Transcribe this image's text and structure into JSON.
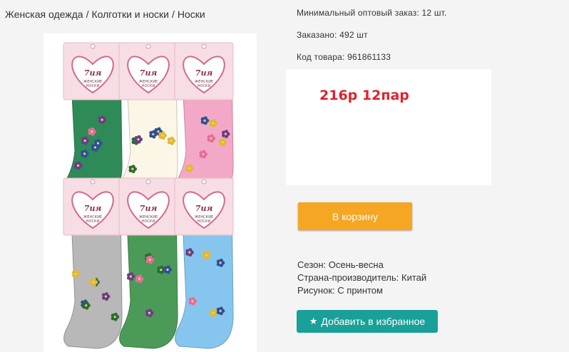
{
  "breadcrumb": {
    "items": [
      "Женская одежда",
      "Колготки и носки",
      "Носки"
    ],
    "separator": "/"
  },
  "product": {
    "image": {
      "label_brand": "7ия",
      "label_text_1": "ЖЕНСКИЕ",
      "label_text_2": "НОСКИ",
      "sock_colors": [
        "#2e8b57",
        "#fbf6e6",
        "#f4a8c8",
        "#b8b8b8",
        "#4c9a58",
        "#86c6ee"
      ]
    },
    "min_order": "Минимальный оптовый заказ: 12 шт.",
    "ordered": "Заказано: 492 шт",
    "code": "Код товара: 961861133",
    "price": "216р 12пар",
    "cart_button": "В корзину",
    "properties": [
      {
        "label": "Сезон:",
        "value": "Осень-весна"
      },
      {
        "label": "Страна-производитель:",
        "value": "Китай"
      },
      {
        "label": "Рисунок:",
        "value": "С принтом"
      }
    ],
    "favorite_button": "Добавить в избранное",
    "favorite_icon": "star-icon"
  },
  "colors": {
    "accent_orange": "#f5a623",
    "accent_teal": "#18a099",
    "price_red": "#e1222d"
  }
}
